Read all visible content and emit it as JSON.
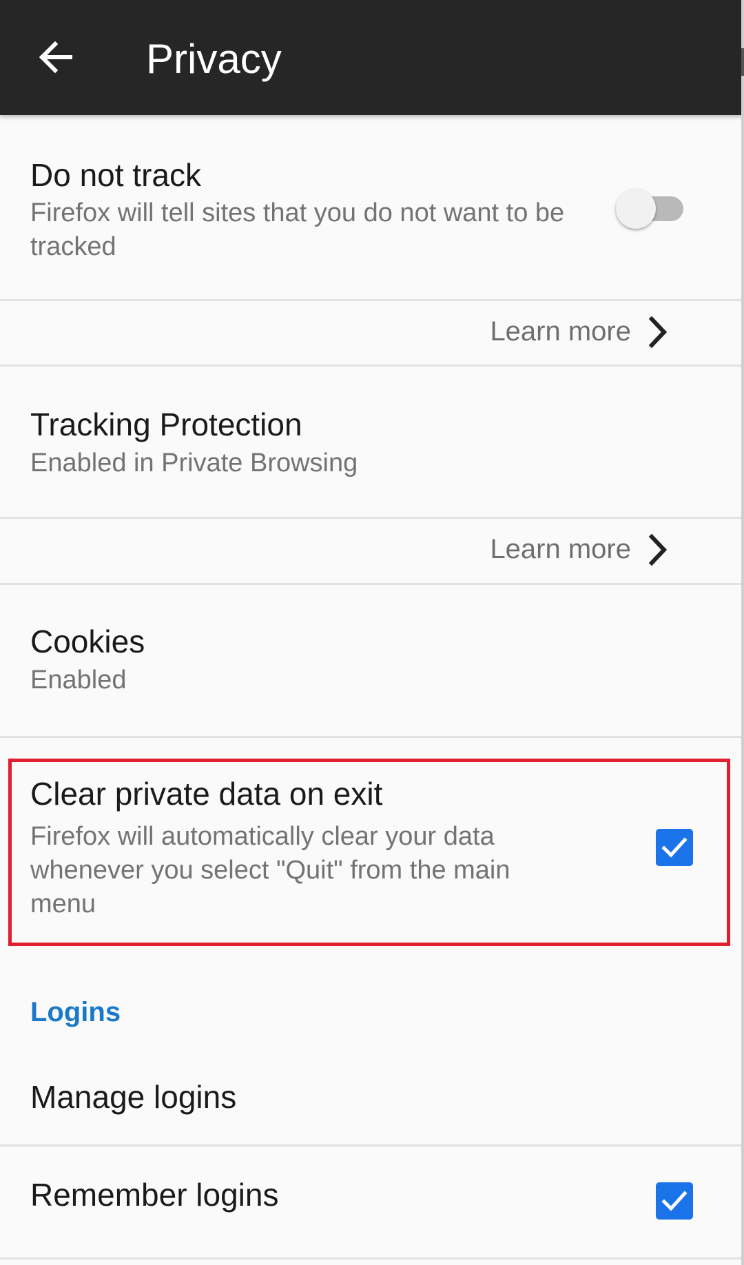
{
  "toolbar": {
    "title": "Privacy",
    "back_icon": "arrow-left-icon"
  },
  "do_not_track": {
    "title": "Do not track",
    "summary": "Firefox will tell sites that you do not want to be tracked",
    "enabled": false
  },
  "learn_more_1": {
    "label": "Learn more",
    "icon": "chevron-right-icon"
  },
  "tracking_protection": {
    "title": "Tracking Protection",
    "summary": "Enabled in Private Browsing"
  },
  "learn_more_2": {
    "label": "Learn more",
    "icon": "chevron-right-icon"
  },
  "cookies": {
    "title": "Cookies",
    "summary": "Enabled"
  },
  "clear_private_data": {
    "title": "Clear private data on exit",
    "summary": "Firefox will automatically clear your data whenever you select \"Quit\" from the main menu",
    "checked": true
  },
  "logins_section": {
    "header": "Logins",
    "manage_logins": "Manage logins",
    "remember_logins": "Remember logins",
    "remember_checked": true
  },
  "colors": {
    "toolbar_bg": "#262626",
    "accent": "#1a73e8",
    "section_header": "#1978c8",
    "highlight": "#e02030"
  }
}
